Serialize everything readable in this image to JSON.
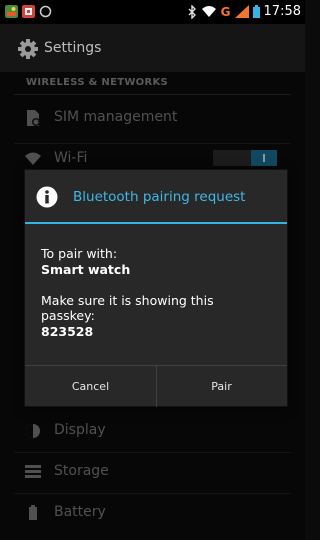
{
  "status_bar": {
    "time": "17:58",
    "network_label": "G"
  },
  "action_bar": {
    "title": "Settings",
    "icon": "settings-gear-icon"
  },
  "section": {
    "title": "WIRELESS & NETWORKS"
  },
  "settings_items": [
    {
      "label": "SIM management",
      "icon": "sim-card-icon"
    },
    {
      "label": "Wi-Fi",
      "icon": "wifi-icon",
      "toggle": "on"
    },
    {
      "label": "Display",
      "icon": "display-icon"
    },
    {
      "label": "Storage",
      "icon": "storage-icon"
    },
    {
      "label": "Battery",
      "icon": "battery-icon"
    }
  ],
  "dialog": {
    "title": "Bluetooth pairing request",
    "icon": "info-icon",
    "line1": "To pair with:",
    "device": "Smart watch",
    "line2": "Make sure it is showing this passkey:",
    "passkey": "823528",
    "cancel_label": "Cancel",
    "pair_label": "Pair"
  },
  "colors": {
    "accent": "#33b5e5",
    "dialog_bg": "#282828",
    "toggle_on": "#1c6f93"
  }
}
